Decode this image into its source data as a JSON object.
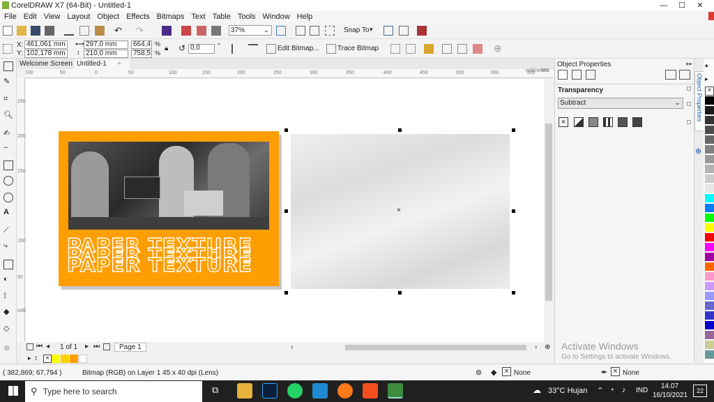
{
  "window": {
    "title": "CorelDRAW X7 (64-Bit) - Untitled-1",
    "minimize": "—",
    "maximize": "☐",
    "close": "✕"
  },
  "menu": [
    "File",
    "Edit",
    "View",
    "Layout",
    "Object",
    "Effects",
    "Bitmaps",
    "Text",
    "Table",
    "Tools",
    "Window",
    "Help"
  ],
  "toolbar1": {
    "zoom": "37%",
    "snap_to": "Snap To"
  },
  "toolbar2": {
    "x": "461,061 mm",
    "y": "102,178 mm",
    "x_label": "X:",
    "y_label": "Y:",
    "width": "297,0 mm",
    "height": "210,0 mm",
    "scale_w": "664,4",
    "scale_h": "758,5",
    "percent": "%",
    "angle": "0,0",
    "degree": "°",
    "edit_bitmap": "Edit Bitmap...",
    "trace_bitmap": "Trace Bitmap"
  },
  "tabs": {
    "welcome": "Welcome Screen",
    "doc": "Untitled-1",
    "add": "+"
  },
  "ruler": {
    "h_labels": [
      "100",
      "50",
      "0",
      "50",
      "100",
      "150",
      "200",
      "250",
      "300",
      "350",
      "400",
      "450",
      "500",
      "550",
      "600",
      "650"
    ],
    "unit": "millimeters",
    "v_labels": [
      "250",
      "200",
      "150",
      "100",
      "50"
    ],
    "v_unit": "millimeters"
  },
  "artwork": {
    "headline": "PAPER TEXTURE"
  },
  "pagenav": {
    "count": "1 of 1",
    "page_tab": "Page 1"
  },
  "status": {
    "coords": "( 382,869; 67,794 )",
    "info": "Bitmap (RGB) on Layer 1 45 x 40 dpi  (Lens)",
    "fill": "None",
    "outline": "None"
  },
  "docker": {
    "title": "Object Properties",
    "section": "Transparency",
    "mode": "Subtract",
    "side_tab": "Object Properties"
  },
  "activate": {
    "title": "Activate Windows",
    "subtitle": "Go to Settings to activate Windows."
  },
  "taskbar": {
    "search_placeholder": "Type here to search",
    "weather": "33°C  Hujan",
    "lang": "IND",
    "time": "14.07",
    "date": "16/10/2021",
    "notif": "22"
  },
  "colors": {
    "accent_orange": "#ff9e00",
    "palette": [
      "#ffffff",
      "#000000",
      "#1a1a1a",
      "#333333",
      "#4d4d4d",
      "#666666",
      "#808080",
      "#999999",
      "#b3b3b3",
      "#cccccc",
      "#e6e6e6",
      "#00ffff",
      "#0080ff",
      "#00ff00",
      "#ffff00",
      "#ff0000",
      "#ff00ff",
      "#a000a0",
      "#ff6600",
      "#ff99cc",
      "#cc99ff",
      "#9999ff",
      "#6666cc",
      "#3333cc",
      "#0000cc",
      "#996699",
      "#cccc99",
      "#669999"
    ]
  }
}
